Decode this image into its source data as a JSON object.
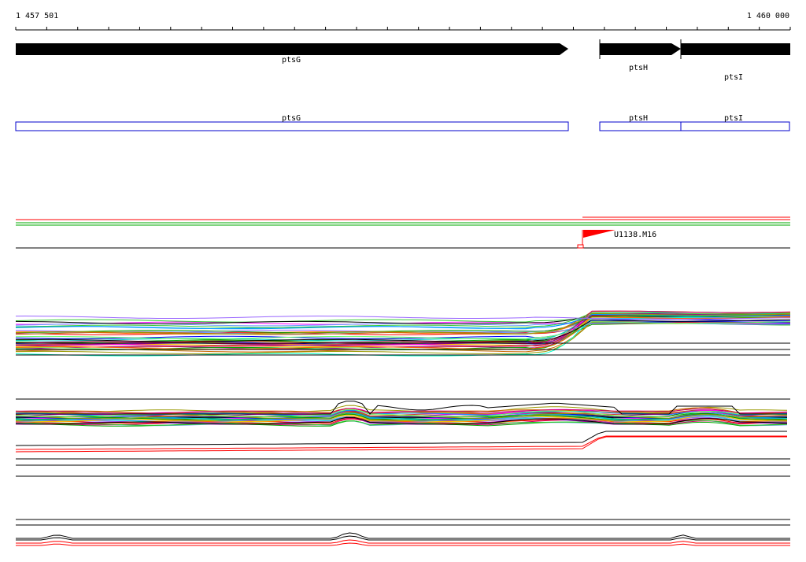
{
  "ruler": {
    "start_label": "1 457 501",
    "end_label": "1 460 000",
    "start": 1457501,
    "end": 1460000
  },
  "genes": [
    {
      "name": "ptsG",
      "start": 1457501,
      "end": 1459290,
      "strand": "+"
    },
    {
      "name": "ptsH",
      "start": 1459390,
      "end": 1459655,
      "strand": "+"
    },
    {
      "name": "ptsI",
      "start": 1459655,
      "end": 1460000,
      "strand": "+"
    }
  ],
  "transcripts": [
    {
      "name": "ptsG",
      "start": 1457501,
      "end": 1459290
    },
    {
      "name": "ptsH",
      "start": 1459390,
      "end": 1459655
    },
    {
      "name": "ptsI",
      "start": 1459655,
      "end": 1460000
    }
  ],
  "tss_marker": {
    "label": "U1138.M16",
    "position": 1459375,
    "color": "#ff0000"
  },
  "colors": {
    "gene": "#000000",
    "transcript_box": "#0000cc",
    "red": "#ff0000",
    "green": "#00aa00"
  }
}
